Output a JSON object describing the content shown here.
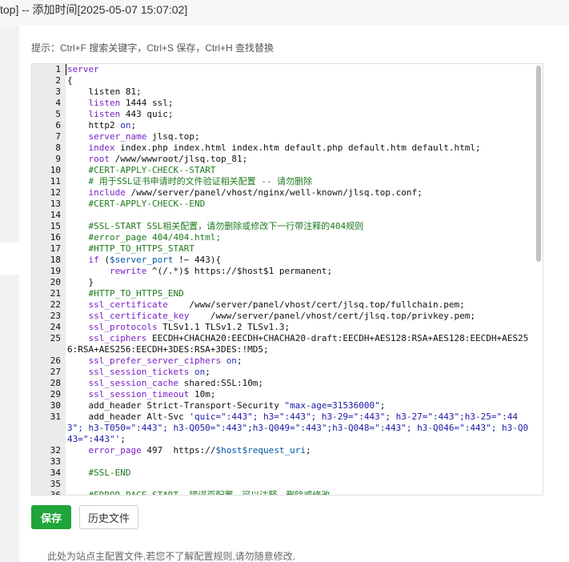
{
  "window": {
    "title": "top] -- 添加时间[2025-05-07 15:07:02]"
  },
  "hint": "提示：Ctrl+F 搜索关键字，Ctrl+S 保存，Ctrl+H 查找替换",
  "editor": {
    "lines": [
      {
        "n": "1",
        "segs": [
          {
            "t": "server",
            "c": "k-dir"
          }
        ]
      },
      {
        "n": "2",
        "segs": [
          {
            "t": "{",
            "c": ""
          }
        ]
      },
      {
        "n": "3",
        "segs": [
          {
            "t": "    listen 81;",
            "c": ""
          }
        ]
      },
      {
        "n": "4",
        "segs": [
          {
            "t": "    listen ",
            "c": "k-dir"
          },
          {
            "t": "1444 ssl;",
            "c": ""
          }
        ]
      },
      {
        "n": "5",
        "segs": [
          {
            "t": "    listen ",
            "c": "k-dir"
          },
          {
            "t": "443 quic;",
            "c": ""
          }
        ]
      },
      {
        "n": "6",
        "segs": [
          {
            "t": "    http2 ",
            "c": ""
          },
          {
            "t": "on",
            "c": "k-blue"
          },
          {
            "t": ";",
            "c": ""
          }
        ]
      },
      {
        "n": "7",
        "segs": [
          {
            "t": "    server_name ",
            "c": "k-dir"
          },
          {
            "t": "jlsq.top;",
            "c": ""
          }
        ]
      },
      {
        "n": "8",
        "segs": [
          {
            "t": "    index ",
            "c": "k-dir"
          },
          {
            "t": "index.php index.html index.htm default.php default.htm default.html;",
            "c": ""
          }
        ]
      },
      {
        "n": "9",
        "segs": [
          {
            "t": "    root ",
            "c": "k-dir"
          },
          {
            "t": "/www/wwwroot/jlsq.top_81;",
            "c": ""
          }
        ]
      },
      {
        "n": "10",
        "segs": [
          {
            "t": "    #CERT-APPLY-CHECK--START",
            "c": "k-cmt"
          }
        ]
      },
      {
        "n": "11",
        "segs": [
          {
            "t": "    # 用于SSL证书申请时的文件验证相关配置 -- 请勿删除",
            "c": "k-cmt"
          }
        ]
      },
      {
        "n": "12",
        "segs": [
          {
            "t": "    include ",
            "c": "k-dir"
          },
          {
            "t": "/www/server/panel/vhost/nginx/well-known/jlsq.top.conf;",
            "c": ""
          }
        ]
      },
      {
        "n": "13",
        "segs": [
          {
            "t": "    #CERT-APPLY-CHECK--END",
            "c": "k-cmt"
          }
        ]
      },
      {
        "n": "14",
        "segs": [
          {
            "t": "",
            "c": ""
          }
        ]
      },
      {
        "n": "15",
        "segs": [
          {
            "t": "    #SSL-START SSL相关配置，请勿删除或修改下一行带注释的404规则",
            "c": "k-cmt"
          }
        ]
      },
      {
        "n": "16",
        "segs": [
          {
            "t": "    #error_page 404/404.html;",
            "c": "k-cmt"
          }
        ]
      },
      {
        "n": "17",
        "segs": [
          {
            "t": "    #HTTP_TO_HTTPS_START",
            "c": "k-cmt"
          }
        ]
      },
      {
        "n": "18",
        "segs": [
          {
            "t": "    if ",
            "c": "k-dir"
          },
          {
            "t": "(",
            "c": ""
          },
          {
            "t": "$server_port",
            "c": "k-var"
          },
          {
            "t": " !~ 443){",
            "c": ""
          }
        ]
      },
      {
        "n": "19",
        "segs": [
          {
            "t": "        rewrite ",
            "c": "k-dir"
          },
          {
            "t": "^(/.*)$ https://$host$1 permanent;",
            "c": ""
          }
        ]
      },
      {
        "n": "20",
        "segs": [
          {
            "t": "    }",
            "c": ""
          }
        ]
      },
      {
        "n": "21",
        "segs": [
          {
            "t": "    #HTTP_TO_HTTPS_END",
            "c": "k-cmt"
          }
        ]
      },
      {
        "n": "22",
        "segs": [
          {
            "t": "    ssl_certificate    ",
            "c": "k-dir"
          },
          {
            "t": "/www/server/panel/vhost/cert/jlsq.top/fullchain.pem;",
            "c": ""
          }
        ]
      },
      {
        "n": "23",
        "segs": [
          {
            "t": "    ssl_certificate_key    ",
            "c": "k-dir"
          },
          {
            "t": "/www/server/panel/vhost/cert/jlsq.top/privkey.pem;",
            "c": ""
          }
        ]
      },
      {
        "n": "24",
        "segs": [
          {
            "t": "    ssl_protocols ",
            "c": "k-dir"
          },
          {
            "t": "TLSv1.1 TLSv1.2 TLSv1.3;",
            "c": ""
          }
        ]
      },
      {
        "n": "25",
        "segs": [
          {
            "t": "    ssl_ciphers ",
            "c": "k-dir"
          },
          {
            "t": "EECDH+CHACHA20:EECDH+CHACHA20-draft:EECDH+AES128:RSA+AES128:EECDH+AES256:RSA+AES256:EECDH+3DES:RSA+3DES:!MD5;",
            "c": ""
          }
        ]
      },
      {
        "n": "26",
        "segs": [
          {
            "t": "    ssl_prefer_server_ciphers ",
            "c": "k-dir"
          },
          {
            "t": "on",
            "c": "k-blue"
          },
          {
            "t": ";",
            "c": ""
          }
        ]
      },
      {
        "n": "27",
        "segs": [
          {
            "t": "    ssl_session_tickets ",
            "c": "k-dir"
          },
          {
            "t": "on",
            "c": "k-blue"
          },
          {
            "t": ";",
            "c": ""
          }
        ]
      },
      {
        "n": "28",
        "segs": [
          {
            "t": "    ssl_session_cache ",
            "c": "k-dir"
          },
          {
            "t": "shared:SSL:10m;",
            "c": ""
          }
        ]
      },
      {
        "n": "29",
        "segs": [
          {
            "t": "    ssl_session_timeout ",
            "c": "k-dir"
          },
          {
            "t": "10m;",
            "c": ""
          }
        ]
      },
      {
        "n": "30",
        "segs": [
          {
            "t": "    add_header ",
            "c": ""
          },
          {
            "t": "Strict-Transport-Security ",
            "c": ""
          },
          {
            "t": "\"max-age=31536000\"",
            "c": "k-str"
          },
          {
            "t": ";",
            "c": ""
          }
        ]
      },
      {
        "n": "31",
        "segs": [
          {
            "t": "    add_header ",
            "c": ""
          },
          {
            "t": "Alt-Svc ",
            "c": ""
          },
          {
            "t": "'quic=\":443\"; h3=\":443\"; h3-29=\":443\"; h3-27=\":443\";h3-25=\":443\"; h3-T050=\":443\"; h3-Q050=\":443\";h3-Q049=\":443\";h3-Q048=\":443\"; h3-Q046=\":443\"; h3-Q043=\":443\"'",
            "c": "k-str"
          },
          {
            "t": ";",
            "c": ""
          }
        ]
      },
      {
        "n": "32",
        "segs": [
          {
            "t": "    error_page ",
            "c": "k-dir"
          },
          {
            "t": "497  https://",
            "c": ""
          },
          {
            "t": "$host$request_uri",
            "c": "k-var"
          },
          {
            "t": ";",
            "c": ""
          }
        ]
      },
      {
        "n": "33",
        "segs": [
          {
            "t": "",
            "c": ""
          }
        ]
      },
      {
        "n": "34",
        "segs": [
          {
            "t": "    #SSL-END",
            "c": "k-cmt"
          }
        ]
      },
      {
        "n": "35",
        "segs": [
          {
            "t": "",
            "c": ""
          }
        ]
      },
      {
        "n": "36",
        "segs": [
          {
            "t": "    #ERROR-PAGE-START  错误页配置，可以注释、删除或修改",
            "c": "k-cmt"
          }
        ]
      }
    ]
  },
  "buttons": {
    "save": "保存",
    "history": "历史文件"
  },
  "footer_note": "此处为站点主配置文件,若您不了解配置规则,请勿随意修改."
}
